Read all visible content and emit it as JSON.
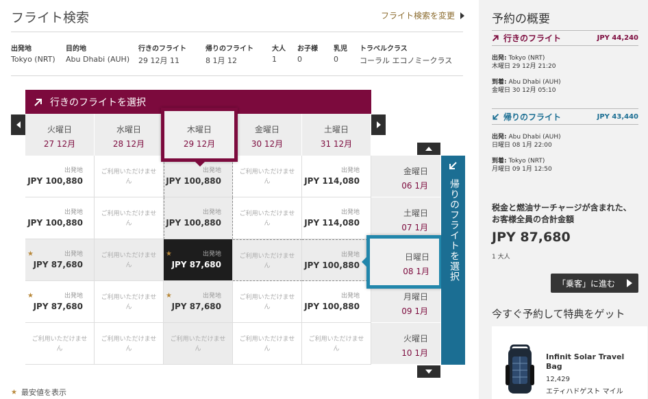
{
  "header": {
    "title": "フライト検索",
    "modify_link": "フライト検索を変更"
  },
  "search_summary": {
    "columns": [
      "出発地",
      "目的地",
      "行きのフライト",
      "帰りのフライト",
      "大人",
      "お子様",
      "乳児",
      "トラベルクラス"
    ],
    "values": [
      "Tokyo (NRT)",
      "Abu Dhabi (AUH)",
      "29 12月 11",
      "8 1月 12",
      "1",
      "0",
      "0",
      "コーラル エコノミークラス"
    ]
  },
  "outbound_header": "行きのフライトを選択",
  "return_header": "帰りのフライトを選択",
  "outbound_days": [
    {
      "dow": "火曜日",
      "date": "27 12月"
    },
    {
      "dow": "水曜日",
      "date": "28 12月"
    },
    {
      "dow": "木曜日",
      "date": "29 12月"
    },
    {
      "dow": "金曜日",
      "date": "30 12月"
    },
    {
      "dow": "土曜日",
      "date": "31 12月"
    }
  ],
  "return_days": [
    {
      "dow": "金曜日",
      "date": "06 1月"
    },
    {
      "dow": "土曜日",
      "date": "07 1月"
    },
    {
      "dow": "日曜日",
      "date": "08 1月"
    },
    {
      "dow": "月曜日",
      "date": "09 1月"
    },
    {
      "dow": "火曜日",
      "date": "10 1月"
    }
  ],
  "from_label": "出発地",
  "na_text": "ご利用いただけません",
  "grid": [
    [
      "JPY 100,880",
      null,
      "JPY 100,880",
      null,
      "JPY 114,080"
    ],
    [
      "JPY 100,880",
      null,
      "JPY 100,880",
      null,
      "JPY 114,080"
    ],
    [
      "JPY 87,680",
      null,
      "JPY 87,680",
      null,
      "JPY 100,880"
    ],
    [
      "JPY 87,680",
      null,
      "JPY 87,680",
      null,
      "JPY 100,880"
    ],
    [
      null,
      null,
      null,
      null,
      null
    ]
  ],
  "stars": [
    [
      2,
      0
    ],
    [
      2,
      2
    ],
    [
      3,
      0
    ],
    [
      3,
      2
    ]
  ],
  "selected": {
    "row": 2,
    "col": 2
  },
  "lowest_legend": "最安値を表示",
  "sidebar": {
    "title": "予約の概要",
    "outbound": {
      "title": "行きのフライト",
      "price": "JPY 44,240",
      "dep_label": "出発:",
      "dep_place": "Tokyo (NRT)",
      "dep_time": "木曜日 29 12月 21:20",
      "arr_label": "到着:",
      "arr_place": "Abu Dhabi (AUH)",
      "arr_time": "金曜日 30 12月 05:10"
    },
    "return": {
      "title": "帰りのフライト",
      "price": "JPY 43,440",
      "dep_label": "出発:",
      "dep_place": "Abu Dhabi (AUH)",
      "dep_time": "日曜日 08 1月 22:00",
      "arr_label": "到着:",
      "arr_place": "Tokyo (NRT)",
      "arr_time": "月曜日 09 1月 12:50"
    },
    "total_label": "税金と燃油サーチャージが含まれた、お客様全員の合計金額",
    "total_price": "JPY 87,680",
    "pax": "1 大人",
    "next_button": "「乗客」に進む",
    "promo_title": "今すぐ予約して特典をゲット",
    "promo_name": "Infinit Solar Travel Bag",
    "promo_points": "12,429",
    "promo_unit": "エティハドゲスト マイル"
  },
  "colors": {
    "outbound": "#7c0a3d",
    "return": "#1b6e93",
    "highlight_return": "#2186ab",
    "gold": "#b8883a"
  }
}
